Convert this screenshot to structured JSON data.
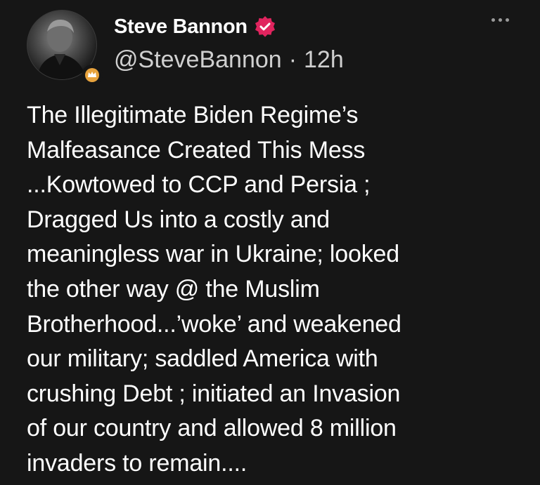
{
  "post": {
    "author": {
      "display_name": "Steve Bannon",
      "handle": "@SteveBannon",
      "verified": true,
      "verified_icon": "verified-check-icon",
      "verified_color": "#e0245e",
      "avatar_badge_icon": "crown-badge-icon",
      "avatar_badge_color": "#e8a33d"
    },
    "separator": "·",
    "timestamp": "12h",
    "more_icon": "more-options-icon",
    "text_lines": [
      "The Illegitimate Biden Regime’s",
      "Malfeasance Created This Mess",
      "...Kowtowed to CCP and Persia ;",
      "Dragged Us into a costly and",
      "meaningless war in Ukraine; looked",
      "the other way @ the Muslim",
      "Brotherhood...’woke’ and weakened",
      "our military; saddled America with",
      "crushing Debt ; initiated an Invasion",
      "of our country and allowed 8 million",
      "invaders to remain...."
    ]
  },
  "theme": {
    "background": "#161616",
    "text": "#ffffff",
    "secondary_text": "#d0d0d0"
  }
}
